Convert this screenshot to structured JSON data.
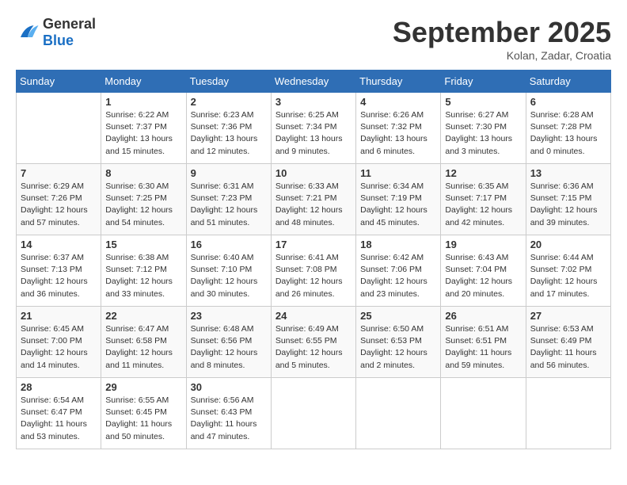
{
  "header": {
    "logo_general": "General",
    "logo_blue": "Blue",
    "month_title": "September 2025",
    "location": "Kolan, Zadar, Croatia"
  },
  "days_of_week": [
    "Sunday",
    "Monday",
    "Tuesday",
    "Wednesday",
    "Thursday",
    "Friday",
    "Saturday"
  ],
  "weeks": [
    [
      {
        "day": "",
        "info": ""
      },
      {
        "day": "1",
        "info": "Sunrise: 6:22 AM\nSunset: 7:37 PM\nDaylight: 13 hours and 15 minutes."
      },
      {
        "day": "2",
        "info": "Sunrise: 6:23 AM\nSunset: 7:36 PM\nDaylight: 13 hours and 12 minutes."
      },
      {
        "day": "3",
        "info": "Sunrise: 6:25 AM\nSunset: 7:34 PM\nDaylight: 13 hours and 9 minutes."
      },
      {
        "day": "4",
        "info": "Sunrise: 6:26 AM\nSunset: 7:32 PM\nDaylight: 13 hours and 6 minutes."
      },
      {
        "day": "5",
        "info": "Sunrise: 6:27 AM\nSunset: 7:30 PM\nDaylight: 13 hours and 3 minutes."
      },
      {
        "day": "6",
        "info": "Sunrise: 6:28 AM\nSunset: 7:28 PM\nDaylight: 13 hours and 0 minutes."
      }
    ],
    [
      {
        "day": "7",
        "info": "Sunrise: 6:29 AM\nSunset: 7:26 PM\nDaylight: 12 hours and 57 minutes."
      },
      {
        "day": "8",
        "info": "Sunrise: 6:30 AM\nSunset: 7:25 PM\nDaylight: 12 hours and 54 minutes."
      },
      {
        "day": "9",
        "info": "Sunrise: 6:31 AM\nSunset: 7:23 PM\nDaylight: 12 hours and 51 minutes."
      },
      {
        "day": "10",
        "info": "Sunrise: 6:33 AM\nSunset: 7:21 PM\nDaylight: 12 hours and 48 minutes."
      },
      {
        "day": "11",
        "info": "Sunrise: 6:34 AM\nSunset: 7:19 PM\nDaylight: 12 hours and 45 minutes."
      },
      {
        "day": "12",
        "info": "Sunrise: 6:35 AM\nSunset: 7:17 PM\nDaylight: 12 hours and 42 minutes."
      },
      {
        "day": "13",
        "info": "Sunrise: 6:36 AM\nSunset: 7:15 PM\nDaylight: 12 hours and 39 minutes."
      }
    ],
    [
      {
        "day": "14",
        "info": "Sunrise: 6:37 AM\nSunset: 7:13 PM\nDaylight: 12 hours and 36 minutes."
      },
      {
        "day": "15",
        "info": "Sunrise: 6:38 AM\nSunset: 7:12 PM\nDaylight: 12 hours and 33 minutes."
      },
      {
        "day": "16",
        "info": "Sunrise: 6:40 AM\nSunset: 7:10 PM\nDaylight: 12 hours and 30 minutes."
      },
      {
        "day": "17",
        "info": "Sunrise: 6:41 AM\nSunset: 7:08 PM\nDaylight: 12 hours and 26 minutes."
      },
      {
        "day": "18",
        "info": "Sunrise: 6:42 AM\nSunset: 7:06 PM\nDaylight: 12 hours and 23 minutes."
      },
      {
        "day": "19",
        "info": "Sunrise: 6:43 AM\nSunset: 7:04 PM\nDaylight: 12 hours and 20 minutes."
      },
      {
        "day": "20",
        "info": "Sunrise: 6:44 AM\nSunset: 7:02 PM\nDaylight: 12 hours and 17 minutes."
      }
    ],
    [
      {
        "day": "21",
        "info": "Sunrise: 6:45 AM\nSunset: 7:00 PM\nDaylight: 12 hours and 14 minutes."
      },
      {
        "day": "22",
        "info": "Sunrise: 6:47 AM\nSunset: 6:58 PM\nDaylight: 12 hours and 11 minutes."
      },
      {
        "day": "23",
        "info": "Sunrise: 6:48 AM\nSunset: 6:56 PM\nDaylight: 12 hours and 8 minutes."
      },
      {
        "day": "24",
        "info": "Sunrise: 6:49 AM\nSunset: 6:55 PM\nDaylight: 12 hours and 5 minutes."
      },
      {
        "day": "25",
        "info": "Sunrise: 6:50 AM\nSunset: 6:53 PM\nDaylight: 12 hours and 2 minutes."
      },
      {
        "day": "26",
        "info": "Sunrise: 6:51 AM\nSunset: 6:51 PM\nDaylight: 11 hours and 59 minutes."
      },
      {
        "day": "27",
        "info": "Sunrise: 6:53 AM\nSunset: 6:49 PM\nDaylight: 11 hours and 56 minutes."
      }
    ],
    [
      {
        "day": "28",
        "info": "Sunrise: 6:54 AM\nSunset: 6:47 PM\nDaylight: 11 hours and 53 minutes."
      },
      {
        "day": "29",
        "info": "Sunrise: 6:55 AM\nSunset: 6:45 PM\nDaylight: 11 hours and 50 minutes."
      },
      {
        "day": "30",
        "info": "Sunrise: 6:56 AM\nSunset: 6:43 PM\nDaylight: 11 hours and 47 minutes."
      },
      {
        "day": "",
        "info": ""
      },
      {
        "day": "",
        "info": ""
      },
      {
        "day": "",
        "info": ""
      },
      {
        "day": "",
        "info": ""
      }
    ]
  ]
}
